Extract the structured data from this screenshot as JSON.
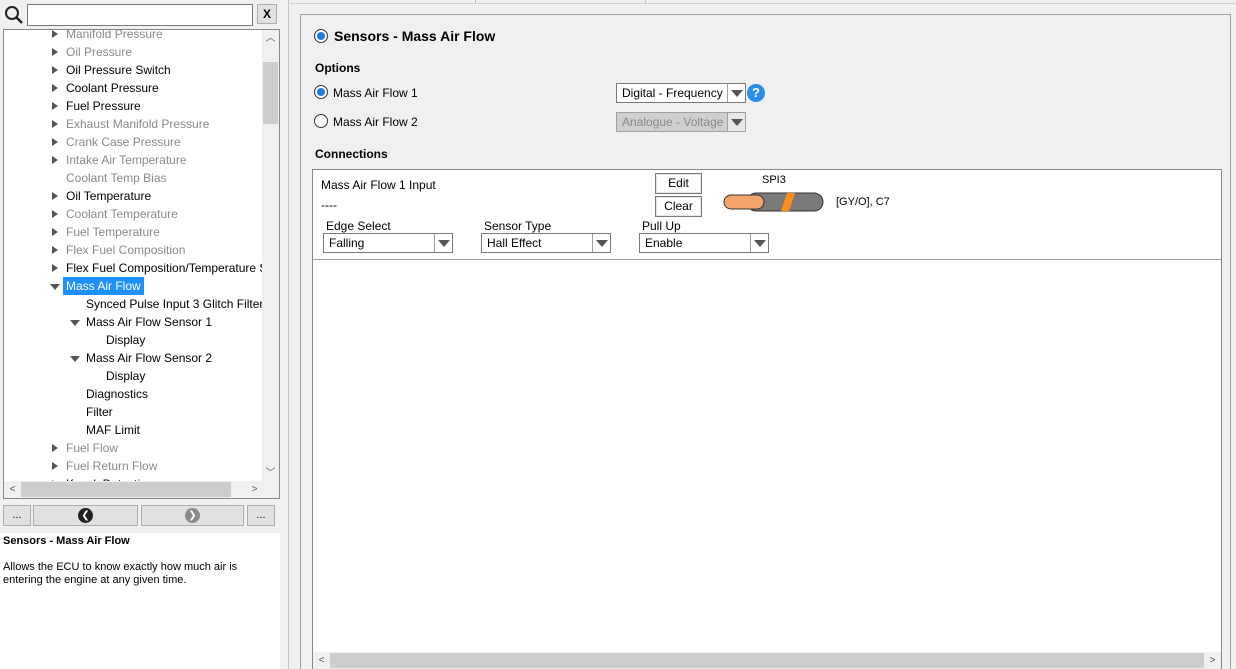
{
  "search": {
    "value": "",
    "clear_label": "X"
  },
  "tree": {
    "items": [
      {
        "label": "Manifold Pressure",
        "style": "gray",
        "arrow": "r",
        "indent": 0
      },
      {
        "label": "Oil Pressure",
        "style": "gray",
        "arrow": "r",
        "indent": 0
      },
      {
        "label": "Oil Pressure Switch",
        "style": "blk",
        "arrow": "r",
        "indent": 0
      },
      {
        "label": "Coolant Pressure",
        "style": "blk",
        "arrow": "r",
        "indent": 0
      },
      {
        "label": "Fuel Pressure",
        "style": "blk",
        "arrow": "r",
        "indent": 0
      },
      {
        "label": "Exhaust Manifold Pressure",
        "style": "gray",
        "arrow": "r",
        "indent": 0
      },
      {
        "label": "Crank Case Pressure",
        "style": "gray",
        "arrow": "r",
        "indent": 0
      },
      {
        "label": "Intake Air Temperature",
        "style": "gray",
        "arrow": "r",
        "indent": 0
      },
      {
        "label": "Coolant Temp Bias",
        "style": "gray",
        "arrow": "",
        "indent": 0
      },
      {
        "label": "Oil Temperature",
        "style": "blk",
        "arrow": "r",
        "indent": 0
      },
      {
        "label": "Coolant Temperature",
        "style": "gray",
        "arrow": "r",
        "indent": 0
      },
      {
        "label": "Fuel Temperature",
        "style": "gray",
        "arrow": "r",
        "indent": 0
      },
      {
        "label": "Flex Fuel Composition",
        "style": "gray",
        "arrow": "r",
        "indent": 0
      },
      {
        "label": "Flex Fuel Composition/Temperature Sensor",
        "style": "blk",
        "arrow": "r",
        "indent": 0
      },
      {
        "label": "Mass Air Flow",
        "style": "sel",
        "arrow": "d",
        "indent": 0
      },
      {
        "label": "Synced Pulse Input 3 Glitch Filter",
        "style": "blk",
        "arrow": "",
        "indent": 1
      },
      {
        "label": "Mass Air Flow Sensor 1",
        "style": "blk",
        "arrow": "d",
        "indent": 1
      },
      {
        "label": "Display",
        "style": "blk",
        "arrow": "",
        "indent": 2
      },
      {
        "label": "Mass Air Flow Sensor 2",
        "style": "blk",
        "arrow": "d",
        "indent": 1
      },
      {
        "label": "Display",
        "style": "blk",
        "arrow": "",
        "indent": 2
      },
      {
        "label": "Diagnostics",
        "style": "blk",
        "arrow": "",
        "indent": 1
      },
      {
        "label": "Filter",
        "style": "blk",
        "arrow": "",
        "indent": 1
      },
      {
        "label": "MAF Limit",
        "style": "blk",
        "arrow": "",
        "indent": 1
      },
      {
        "label": "Fuel Flow",
        "style": "gray",
        "arrow": "r",
        "indent": 0
      },
      {
        "label": "Fuel Return Flow",
        "style": "gray",
        "arrow": "r",
        "indent": 0
      },
      {
        "label": "Knock Detection",
        "style": "blk",
        "arrow": "r",
        "indent": 0
      }
    ]
  },
  "nav": {
    "more_left": "...",
    "more_right": "...",
    "back_glyph": "❮",
    "forward_glyph": "❯"
  },
  "description": {
    "title": "Sensors - Mass Air Flow",
    "body": "Allows the ECU to know exactly how much air is entering the engine at any given time."
  },
  "main": {
    "title": "Sensors - Mass Air Flow",
    "options_header": "Options",
    "maf1_label": "Mass Air Flow 1",
    "maf2_label": "Mass Air Flow 2",
    "maf1_type": "Digital - Frequency",
    "maf2_type": "Analogue - Voltage",
    "help_glyph": "?",
    "connections_header": "Connections",
    "connection": {
      "input_label": "Mass Air Flow 1 Input",
      "input_value": "----",
      "edit_label": "Edit",
      "clear_label": "Clear",
      "pin_label": "SPI3",
      "wire_label": "[GY/O], C7",
      "edge_select_label": "Edge Select",
      "edge_select_value": "Falling",
      "sensor_type_label": "Sensor Type",
      "sensor_type_value": "Hall Effect",
      "pull_up_label": "Pull Up",
      "pull_up_value": "Enable"
    }
  },
  "colors": {
    "selection": "#1e90ff",
    "accent": "#1e7be0",
    "wire_gray": "#7a7a7a",
    "wire_orange": "#f4a46a",
    "stripe_orange": "#ff8c1a"
  }
}
